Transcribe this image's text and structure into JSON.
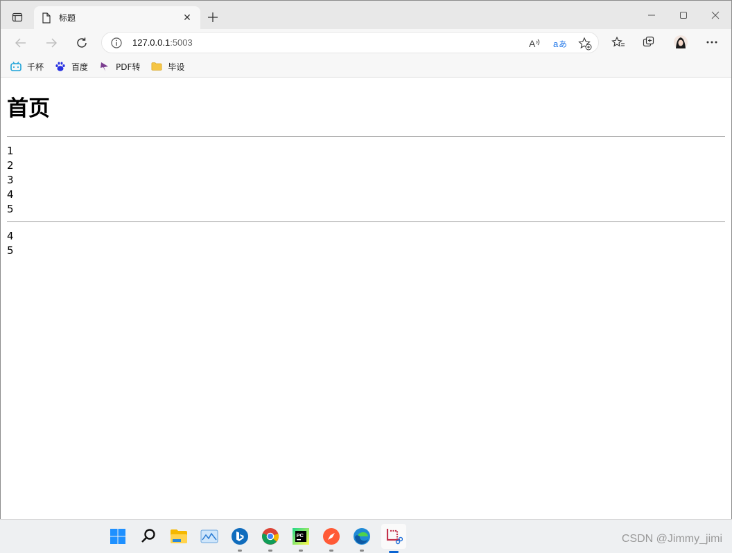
{
  "browser": {
    "tab": {
      "title": "标题"
    },
    "address": {
      "host": "127.0.0.1",
      "port": ":5003"
    },
    "favorites": [
      {
        "label": "千杯",
        "icon": "bilibili-icon"
      },
      {
        "label": "百度",
        "icon": "baidu-paw-icon"
      },
      {
        "label": "PDF转",
        "icon": "pdf-star-icon"
      },
      {
        "label": "毕设",
        "icon": "folder-icon"
      }
    ]
  },
  "page": {
    "heading": "首页",
    "list1": [
      "1",
      "2",
      "3",
      "4",
      "5"
    ],
    "list2": [
      "4",
      "5"
    ]
  },
  "taskbar": {
    "apps": [
      "windows-start-icon",
      "search-icon",
      "file-explorer-icon",
      "photos-icon",
      "bing-icon",
      "chrome-icon",
      "pycharm-icon",
      "compass-icon",
      "edge-icon",
      "snipping-tool-icon"
    ]
  },
  "watermark": "CSDN @Jimmy_jimi"
}
